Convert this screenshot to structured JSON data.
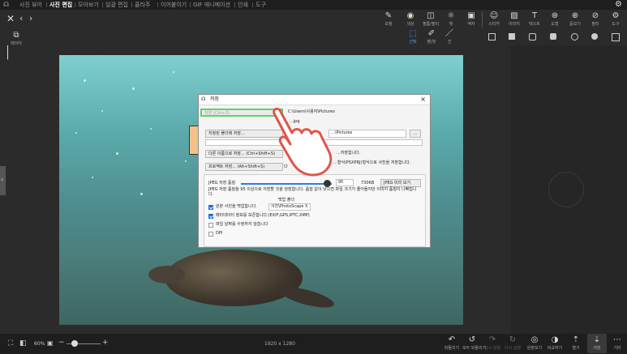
{
  "menu": {
    "items": [
      "사진 뷰어",
      "사진 편집",
      "모아보기",
      "일괄 편집",
      "콜라주",
      "이어붙이기",
      "GIF 애니메이션",
      "인쇄",
      "도구"
    ],
    "active_index": 1
  },
  "toolbar": {
    "tools": [
      {
        "label": "보정",
        "icon": "✎"
      },
      {
        "label": "색상",
        "icon": "◉"
      },
      {
        "label": "필름/필터",
        "icon": "◫"
      },
      {
        "label": "빛",
        "icon": "☼"
      },
      {
        "label": "액자",
        "icon": "▣"
      },
      {
        "label": "스티커",
        "icon": "☺"
      },
      {
        "label": "이미지",
        "icon": "▨"
      },
      {
        "label": "텍스트",
        "icon": "T"
      },
      {
        "label": "도형",
        "icon": "⊛"
      },
      {
        "label": "돋보기",
        "icon": "⊕"
      },
      {
        "label": "필터",
        "icon": "⊘"
      },
      {
        "label": "도구",
        "icon": "⚙"
      }
    ],
    "left_tool_label": "레이어",
    "select_tools": [
      {
        "label": "선택",
        "icon": "⬚"
      },
      {
        "label": "펜/붓",
        "icon": "✐"
      },
      {
        "label": "선",
        "icon": "／"
      }
    ]
  },
  "canvas": {
    "image_size": "1920 x 1280",
    "zoom": "60%"
  },
  "dialog": {
    "title": "저장",
    "close": "×",
    "save_button": "저장 (Ctrl+S)",
    "save_path": "C:\\Users\\사용자\\Pictures",
    "save_file": "...jpg",
    "folder_button": "지정된 폴더에 저장...",
    "folder_path": "...\\Pictures",
    "folder_more": "...",
    "save_as_button": "다른 이름으로 저장...  (Ctrl+Shift+S)",
    "save_as_note": "...저장합니다.",
    "project_button": "프로젝트 저장...  (Alt+Shift+S)",
    "project_note": "...형식(PSXPRJ)형식으로 사진을 저장합니다.",
    "jpeg_quality_label": "JPEG 저장 품질",
    "jpeg_quality_value": "95",
    "jpeg_size": "730KB",
    "jpeg_preview_button": "JPEG 미리 보기",
    "jpeg_note": "JPEG 저장 품질을 95 이상으로 저장할 것을 권장합니다. 품질 값이 낮으면 파일 크기가 줄어들지만 이미지 품질이 나빠집니다.",
    "backup_folder_label": "백업 폴더",
    "opt_backup": "원본 사진을 백업합니다.",
    "backup_folder_value": "사진\\PhotoScape X",
    "opt_metadata": "메타데이터 정보를 보존합니다.(EXIF,GPS,IPTC,XMP)",
    "opt_keep_date": "파일 날짜를 수정하지 않습니다",
    "opt_dpi": "DPI",
    "checks": [
      true,
      true,
      false,
      false
    ]
  },
  "statusbar": {
    "zoom_label": "60%",
    "image_size": "1920 x 1280",
    "actions": [
      {
        "label": "되돌리기",
        "icon": "↶"
      },
      {
        "label": "모두 되돌리기",
        "icon": "↺"
      },
      {
        "label": "다시 실행",
        "icon": "↷"
      },
      {
        "label": "다시 실행",
        "icon": "↻"
      },
      {
        "label": "원본보기",
        "icon": "◎"
      },
      {
        "label": "비교하기",
        "icon": "◑"
      },
      {
        "label": "열기",
        "icon": "⇡"
      },
      {
        "label": "저장",
        "icon": "⇣"
      },
      {
        "label": "기타",
        "icon": "⋯"
      }
    ]
  }
}
